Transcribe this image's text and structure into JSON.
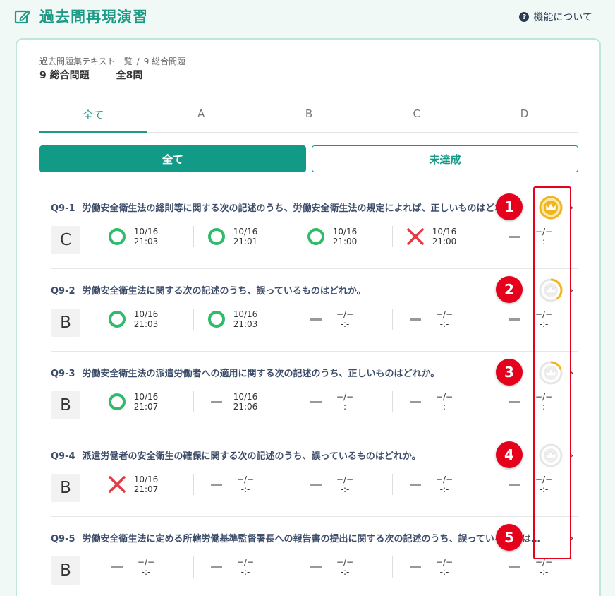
{
  "header": {
    "title": "過去問再現演習",
    "about_icon": "?",
    "about_label": "機能について"
  },
  "breadcrumb": {
    "parent": "過去問題集テキスト一覧",
    "separator": "/",
    "current": "9 総合問題"
  },
  "subheader": {
    "section": "9 総合問題",
    "count": "全8問"
  },
  "tabs": [
    "全て",
    "A",
    "B",
    "C",
    "D"
  ],
  "active_tab": "全て",
  "filters": {
    "all": "全て",
    "unachieved": "未達成"
  },
  "colors": {
    "accent": "#119a86",
    "correct": "#2fbb6a",
    "wrong": "#e53945",
    "crown": "#f2b41d",
    "annotation": "#e5001c"
  },
  "questions": [
    {
      "id": "Q9-1",
      "text": "労働安全衛生法の総則等に関する次の記述のうち、労働安全衛生法の規定によれば、正しいものはどれか。",
      "grade": "C",
      "annotation": "1",
      "crown_progress": 1.0,
      "attempts": [
        {
          "result": "correct",
          "date": "10/16",
          "time": "21:03"
        },
        {
          "result": "correct",
          "date": "10/16",
          "time": "21:01"
        },
        {
          "result": "correct",
          "date": "10/16",
          "time": "21:00"
        },
        {
          "result": "wrong",
          "date": "10/16",
          "time": "21:00"
        },
        {
          "result": "none",
          "date": "−/−",
          "time": "-:-"
        }
      ]
    },
    {
      "id": "Q9-2",
      "text": "労働安全衛生法に関する次の記述のうち、誤っているものはどれか。",
      "grade": "B",
      "annotation": "2",
      "crown_progress": 0.4,
      "attempts": [
        {
          "result": "correct",
          "date": "10/16",
          "time": "21:03"
        },
        {
          "result": "correct",
          "date": "10/16",
          "time": "21:03"
        },
        {
          "result": "none",
          "date": "−/−",
          "time": "-:-"
        },
        {
          "result": "none",
          "date": "−/−",
          "time": "-:-"
        },
        {
          "result": "none",
          "date": "−/−",
          "time": "-:-"
        }
      ]
    },
    {
      "id": "Q9-3",
      "text": "労働安全衛生法の派遣労働者への適用に関する次の記述のうち、正しいものはどれか。",
      "grade": "B",
      "annotation": "3",
      "crown_progress": 0.2,
      "attempts": [
        {
          "result": "correct",
          "date": "10/16",
          "time": "21:07"
        },
        {
          "result": "none",
          "date": "10/16",
          "time": "21:06"
        },
        {
          "result": "none",
          "date": "−/−",
          "time": "-:-"
        },
        {
          "result": "none",
          "date": "−/−",
          "time": "-:-"
        },
        {
          "result": "none",
          "date": "−/−",
          "time": "-:-"
        }
      ]
    },
    {
      "id": "Q9-4",
      "text": "派遣労働者の安全衛生の確保に関する次の記述のうち、誤っているものはどれか。",
      "grade": "B",
      "annotation": "4",
      "crown_progress": 0,
      "attempts": [
        {
          "result": "wrong",
          "date": "10/16",
          "time": "21:07"
        },
        {
          "result": "none",
          "date": "−/−",
          "time": "-:-"
        },
        {
          "result": "none",
          "date": "−/−",
          "time": "-:-"
        },
        {
          "result": "none",
          "date": "−/−",
          "time": "-:-"
        },
        {
          "result": "none",
          "date": "−/−",
          "time": "-:-"
        }
      ]
    },
    {
      "id": "Q9-5",
      "text": "労働安全衛生法に定める所轄労働基準監督署長への報告書の提出に関する次の記述のうち、誤っているものはどれか。",
      "grade": "B",
      "annotation": "5",
      "crown_progress": null,
      "attempts": [
        {
          "result": "none",
          "date": "−/−",
          "time": "-:-"
        },
        {
          "result": "none",
          "date": "−/−",
          "time": "-:-"
        },
        {
          "result": "none",
          "date": "−/−",
          "time": "-:-"
        },
        {
          "result": "none",
          "date": "−/−",
          "time": "-:-"
        },
        {
          "result": "none",
          "date": "−/−",
          "time": "-:-"
        }
      ]
    }
  ]
}
